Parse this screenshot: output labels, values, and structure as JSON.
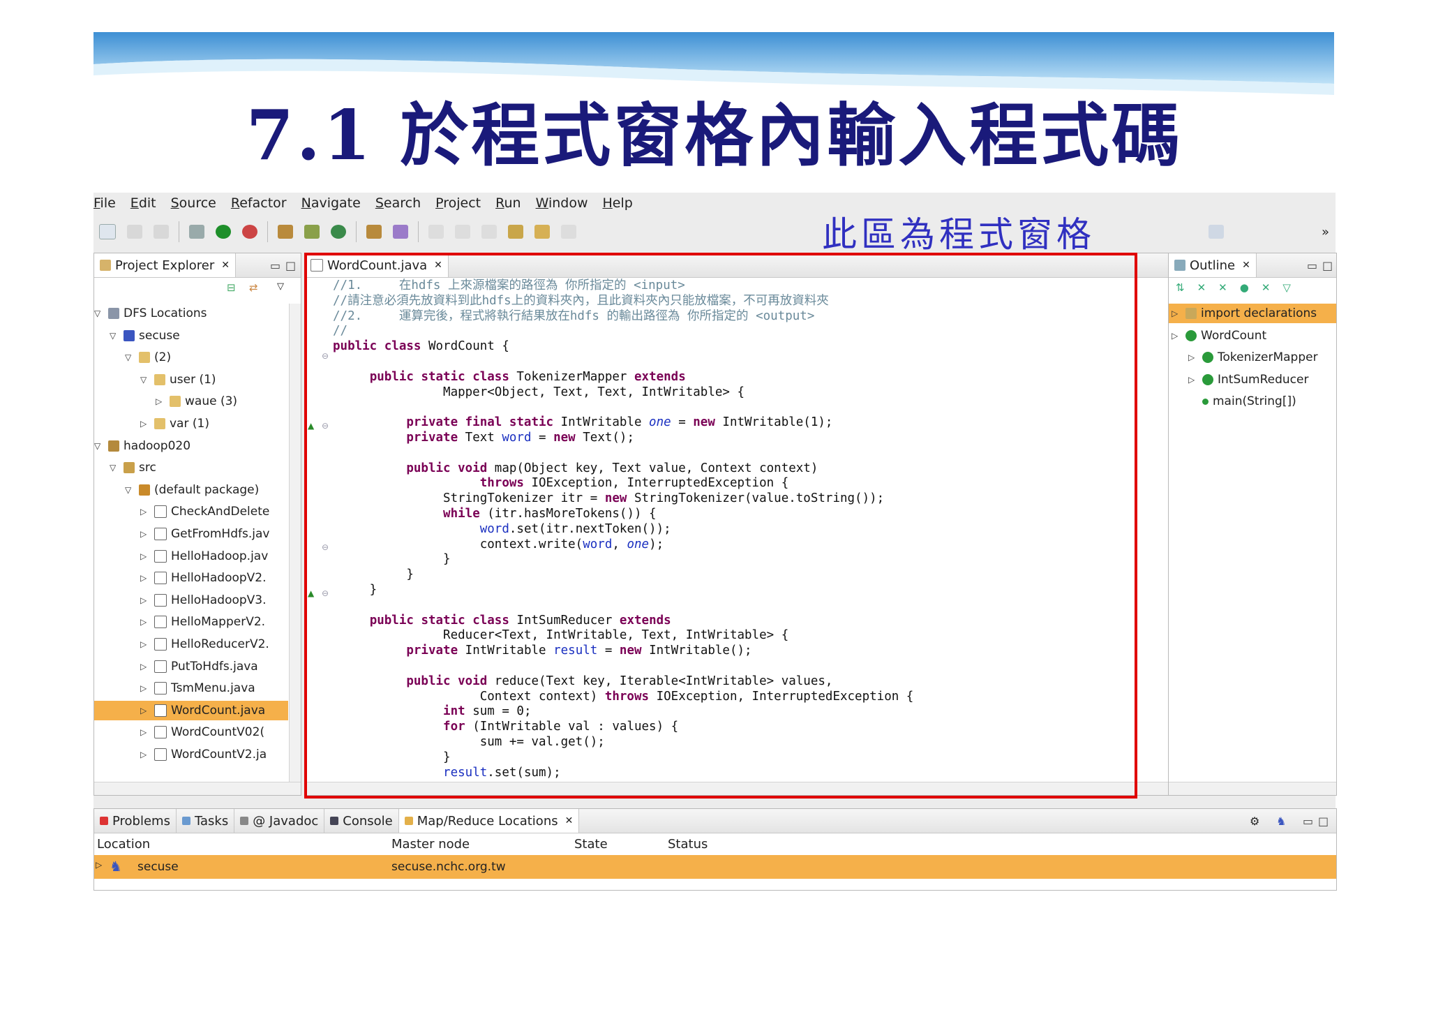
{
  "slide": {
    "title": "7.1 於程式窗格內輸入程式碼",
    "callout": "此區為程式窗格"
  },
  "menu": [
    "File",
    "Edit",
    "Source",
    "Refactor",
    "Navigate",
    "Search",
    "Project",
    "Run",
    "Window",
    "Help"
  ],
  "project_explorer": {
    "title": "Project Explorer",
    "items": [
      {
        "label": "DFS Locations",
        "level": 0,
        "open": true,
        "icon": "dfs-icon"
      },
      {
        "label": "secuse",
        "level": 1,
        "open": true,
        "icon": "elephant-icon"
      },
      {
        "label": "(2)",
        "level": 2,
        "open": true,
        "icon": "folder-icon"
      },
      {
        "label": "user (1)",
        "level": 3,
        "open": true,
        "icon": "folder-icon"
      },
      {
        "label": "waue (3)",
        "level": 4,
        "open": false,
        "icon": "folder-icon"
      },
      {
        "label": "var (1)",
        "level": 3,
        "open": false,
        "icon": "folder-icon"
      },
      {
        "label": "hadoop020",
        "level": 0,
        "open": true,
        "icon": "project-icon"
      },
      {
        "label": "src",
        "level": 1,
        "open": true,
        "icon": "package-folder-icon"
      },
      {
        "label": "(default package)",
        "level": 2,
        "open": true,
        "icon": "package-icon"
      },
      {
        "label": "CheckAndDelete",
        "level": 3,
        "open": false,
        "icon": "java-file-icon"
      },
      {
        "label": "GetFromHdfs.jav",
        "level": 3,
        "open": false,
        "icon": "java-file-icon"
      },
      {
        "label": "HelloHadoop.jav",
        "level": 3,
        "open": false,
        "icon": "java-file-icon"
      },
      {
        "label": "HelloHadoopV2.",
        "level": 3,
        "open": false,
        "icon": "java-file-icon"
      },
      {
        "label": "HelloHadoopV3.",
        "level": 3,
        "open": false,
        "icon": "java-file-icon"
      },
      {
        "label": "HelloMapperV2.",
        "level": 3,
        "open": false,
        "icon": "java-file-icon"
      },
      {
        "label": "HelloReducerV2.",
        "level": 3,
        "open": false,
        "icon": "java-file-icon"
      },
      {
        "label": "PutToHdfs.java",
        "level": 3,
        "open": false,
        "icon": "java-file-icon"
      },
      {
        "label": "TsmMenu.java",
        "level": 3,
        "open": false,
        "icon": "java-file-icon"
      },
      {
        "label": "WordCount.java",
        "level": 3,
        "open": false,
        "icon": "java-file-icon",
        "selected": true
      },
      {
        "label": "WordCountV02(",
        "level": 3,
        "open": false,
        "icon": "java-file-icon"
      },
      {
        "label": "WordCountV2.ja",
        "level": 3,
        "open": false,
        "icon": "java-file-icon"
      }
    ]
  },
  "editor": {
    "tab": "WordCount.java",
    "code": [
      [
        [
          "cm",
          "//1.     在hdfs 上來源檔案的路徑為 你所指定的 <input>"
        ]
      ],
      [
        [
          "cm",
          "//請注意必須先放資料到此hdfs上的資料夾內，且此資料夾內只能放檔案，不可再放資料夾"
        ]
      ],
      [
        [
          "cm",
          "//2.     運算完後，程式將執行結果放在hdfs 的輸出路徑為 你所指定的 <output>"
        ]
      ],
      [
        [
          "cm",
          "//"
        ]
      ],
      [
        [
          "kw",
          "public class"
        ],
        [
          "t",
          " WordCount {"
        ]
      ],
      [
        [
          "t",
          ""
        ]
      ],
      [
        [
          "t",
          "     "
        ],
        [
          "kw",
          "public static class"
        ],
        [
          "t",
          " TokenizerMapper "
        ],
        [
          "kw",
          "extends"
        ]
      ],
      [
        [
          "t",
          "               Mapper<Object, Text, Text, IntWritable> {"
        ]
      ],
      [
        [
          "t",
          ""
        ]
      ],
      [
        [
          "t",
          "          "
        ],
        [
          "kw",
          "private final static"
        ],
        [
          "t",
          " IntWritable "
        ],
        [
          "fld",
          "one"
        ],
        [
          "t",
          " = "
        ],
        [
          "kw",
          "new"
        ],
        [
          "t",
          " IntWritable(1);"
        ]
      ],
      [
        [
          "t",
          "          "
        ],
        [
          "kw",
          "private"
        ],
        [
          "t",
          " Text "
        ],
        [
          "var",
          "word"
        ],
        [
          "t",
          " = "
        ],
        [
          "kw",
          "new"
        ],
        [
          "t",
          " Text();"
        ]
      ],
      [
        [
          "t",
          ""
        ]
      ],
      [
        [
          "t",
          "          "
        ],
        [
          "kw",
          "public void"
        ],
        [
          "t",
          " map(Object key, Text value, Context context)"
        ]
      ],
      [
        [
          "t",
          "                    "
        ],
        [
          "kw",
          "throws"
        ],
        [
          "t",
          " IOException, InterruptedException {"
        ]
      ],
      [
        [
          "t",
          "               StringTokenizer itr = "
        ],
        [
          "kw",
          "new"
        ],
        [
          "t",
          " StringTokenizer(value.toString());"
        ]
      ],
      [
        [
          "t",
          "               "
        ],
        [
          "kw",
          "while"
        ],
        [
          "t",
          " (itr.hasMoreTokens()) {"
        ]
      ],
      [
        [
          "t",
          "                    "
        ],
        [
          "var",
          "word"
        ],
        [
          "t",
          ".set(itr.nextToken());"
        ]
      ],
      [
        [
          "t",
          "                    context.write("
        ],
        [
          "var",
          "word"
        ],
        [
          "t",
          ", "
        ],
        [
          "fld",
          "one"
        ],
        [
          "t",
          ");"
        ]
      ],
      [
        [
          "t",
          "               }"
        ]
      ],
      [
        [
          "t",
          "          }"
        ]
      ],
      [
        [
          "t",
          "     }"
        ]
      ],
      [
        [
          "t",
          ""
        ]
      ],
      [
        [
          "t",
          "     "
        ],
        [
          "kw",
          "public static class"
        ],
        [
          "t",
          " IntSumReducer "
        ],
        [
          "kw",
          "extends"
        ]
      ],
      [
        [
          "t",
          "               Reducer<Text, IntWritable, Text, IntWritable> {"
        ]
      ],
      [
        [
          "t",
          "          "
        ],
        [
          "kw",
          "private"
        ],
        [
          "t",
          " IntWritable "
        ],
        [
          "var",
          "result"
        ],
        [
          "t",
          " = "
        ],
        [
          "kw",
          "new"
        ],
        [
          "t",
          " IntWritable();"
        ]
      ],
      [
        [
          "t",
          ""
        ]
      ],
      [
        [
          "t",
          "          "
        ],
        [
          "kw",
          "public void"
        ],
        [
          "t",
          " reduce(Text key, Iterable<IntWritable> values,"
        ]
      ],
      [
        [
          "t",
          "                    Context context) "
        ],
        [
          "kw",
          "throws"
        ],
        [
          "t",
          " IOException, InterruptedException {"
        ]
      ],
      [
        [
          "t",
          "               "
        ],
        [
          "kw",
          "int"
        ],
        [
          "t",
          " sum = 0;"
        ]
      ],
      [
        [
          "t",
          "               "
        ],
        [
          "kw",
          "for"
        ],
        [
          "t",
          " (IntWritable val : values) {"
        ]
      ],
      [
        [
          "t",
          "                    sum += val.get();"
        ]
      ],
      [
        [
          "t",
          "               }"
        ]
      ],
      [
        [
          "t",
          "               "
        ],
        [
          "var",
          "result"
        ],
        [
          "t",
          ".set(sum);"
        ]
      ]
    ]
  },
  "outline": {
    "title": "Outline",
    "items": [
      {
        "label": "import declarations",
        "level": 0,
        "selected": true,
        "icon": "import-icon"
      },
      {
        "label": "WordCount",
        "level": 0,
        "icon": "class-icon"
      },
      {
        "label": "TokenizerMapper",
        "level": 1,
        "icon": "class-icon"
      },
      {
        "label": "IntSumReducer",
        "level": 1,
        "icon": "class-icon"
      },
      {
        "label": "main(String[])",
        "level": 1,
        "icon": "method-icon"
      }
    ]
  },
  "bottom": {
    "tabs": [
      "Problems",
      "Tasks",
      "@ Javadoc",
      "Console",
      "Map/Reduce Locations"
    ],
    "columns": [
      "Location",
      "Master node",
      "State",
      "Status"
    ],
    "row": {
      "location": "secuse",
      "master": "secuse.nchc.org.tw",
      "state": "",
      "status": ""
    }
  },
  "colors": {
    "selection": "#f5b04a",
    "callout": "#3030c0",
    "title": "#1a1a7a",
    "highlight_box": "#e00000"
  }
}
